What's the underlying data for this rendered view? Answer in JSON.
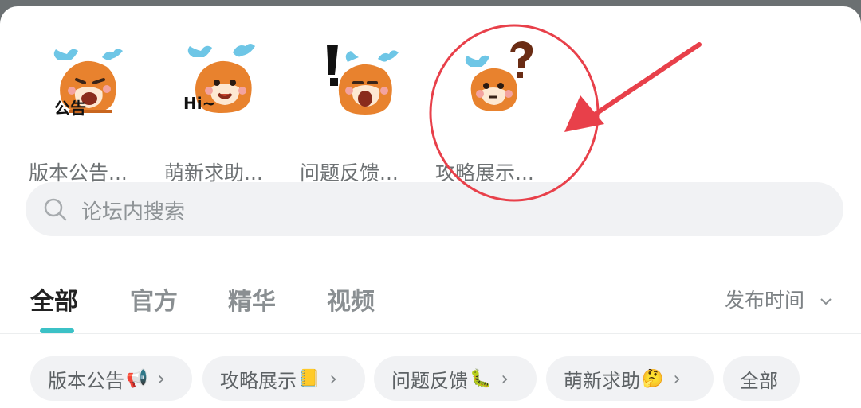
{
  "categories": [
    {
      "label": "版本公告...",
      "sticker_text": "公告",
      "icon": "deer-mascot-announcement"
    },
    {
      "label": "萌新求助...",
      "sticker_text": "Hi~",
      "icon": "deer-mascot-hi"
    },
    {
      "label": "问题反馈...",
      "sticker_text": "!",
      "icon": "deer-mascot-exclaim"
    },
    {
      "label": "攻略展示...",
      "sticker_text": "?",
      "icon": "deer-mascot-question"
    }
  ],
  "search": {
    "placeholder": "论坛内搜索"
  },
  "tabs": [
    {
      "label": "全部",
      "active": true
    },
    {
      "label": "官方",
      "active": false
    },
    {
      "label": "精华",
      "active": false
    },
    {
      "label": "视频",
      "active": false
    }
  ],
  "sort": {
    "label": "发布时间"
  },
  "chips": [
    {
      "label": "版本公告",
      "emoji": "📢"
    },
    {
      "label": "攻略展示",
      "emoji": "📒"
    },
    {
      "label": "问题反馈",
      "emoji": "🐛"
    },
    {
      "label": "萌新求助",
      "emoji": "🤔"
    },
    {
      "label": "全部",
      "emoji": ""
    }
  ],
  "colors": {
    "accent": "#3bc1c6",
    "annotation": "#e8404a",
    "mascot": "#e8822e"
  }
}
